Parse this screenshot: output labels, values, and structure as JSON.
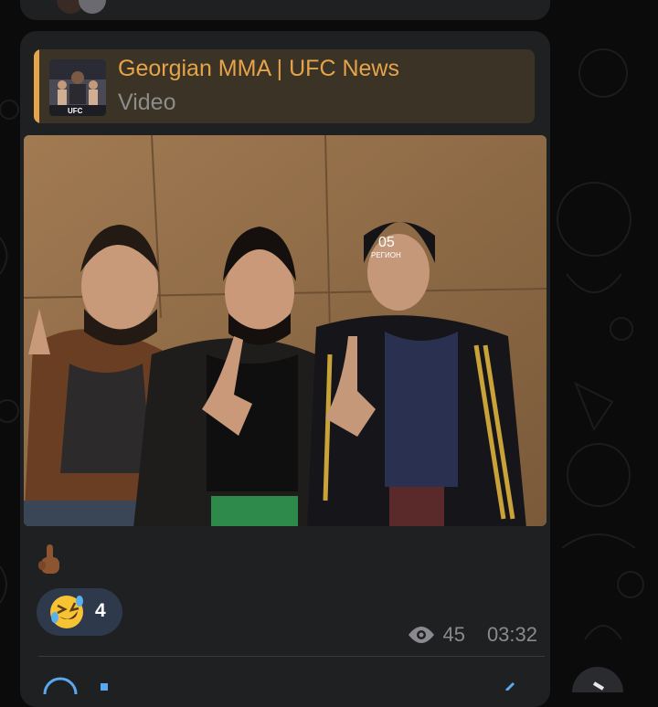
{
  "message": {
    "forward": {
      "channel_name": "Georgian MMA | UFC News",
      "media_type": "Video",
      "thumbnail_text": "UFC",
      "accent_color": "#e6a34a"
    },
    "photo": {
      "beanie_text_top": "05",
      "beanie_text_bottom": "РЕГИОН"
    },
    "caption_emoji": "index-pointing-up-emoji",
    "reaction": {
      "emoji": "rolling-on-floor-laughing-icon",
      "count": "4"
    },
    "views": "45",
    "time": "03:32"
  },
  "colors": {
    "bubble": "#1f2022",
    "background": "#0b0b0c",
    "reaction_bg": "#2e3a4c",
    "meta_text": "#8a8a8e"
  }
}
